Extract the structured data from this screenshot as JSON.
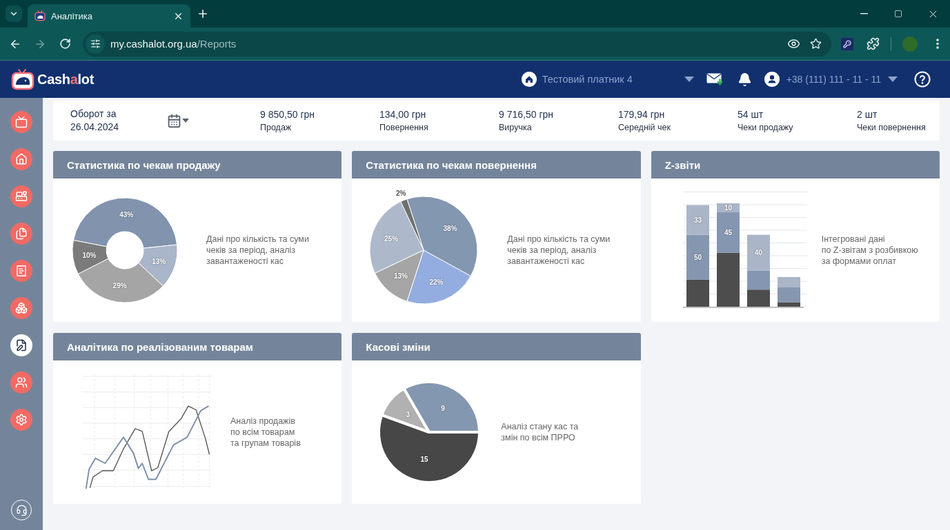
{
  "browser": {
    "tab": {
      "title": "Аналітика"
    },
    "back": {
      "disabled": false
    },
    "forward": {
      "disabled": true
    },
    "address": {
      "host": "my.cashalot.org.ua",
      "path": "/Reports"
    }
  },
  "header": {
    "logo": {
      "before": "Cash",
      "accent": "a",
      "after": "lot"
    },
    "payer": "Тестовий платник 4",
    "phone": "+38 (111) 111 - 11 - 11"
  },
  "sidebar": {
    "items": [
      {
        "selected": false
      },
      {
        "selected": false
      },
      {
        "selected": false
      },
      {
        "selected": false
      },
      {
        "selected": false
      },
      {
        "selected": false
      },
      {
        "selected": true
      },
      {
        "selected": false
      },
      {
        "selected": false
      }
    ]
  },
  "turnover": {
    "title": "Оборот за 26.04.2024",
    "stats": [
      {
        "value": "9 850,50 грн",
        "label": "Продаж"
      },
      {
        "value": "134,00 грн",
        "label": "Повернення"
      },
      {
        "value": "9 716,50 грн",
        "label": "Виручка"
      },
      {
        "value": "179,94 грн",
        "label": "Середній чек"
      },
      {
        "value": "54 шт",
        "label": "Чеки продажу"
      },
      {
        "value": "2 шт",
        "label": "Чеки повернення"
      }
    ]
  },
  "cards": [
    {
      "title": "Статистика по чекам продажу",
      "kind": "donut",
      "description": "Дані про кількість та суми\nчеків за період, аналіз\nзавантаженості кас",
      "chart_data": {
        "type": "donut",
        "values": [
          43,
          13,
          29,
          10
        ],
        "value_labels": [
          "43%",
          "13%",
          "29%",
          "10%"
        ],
        "colors": [
          "#8193ad",
          "#a9b5c9",
          "#a5a5a5",
          "#7b7b7b"
        ],
        "data_labels": true
      }
    },
    {
      "title": "Статистика по чекам повернення",
      "kind": "pie_large",
      "description": "Дані про кількість та суми\nчеків за період, аналіз\nзавантаженості кас",
      "chart_data": {
        "type": "pie",
        "values": [
          38,
          22,
          13,
          25,
          2
        ],
        "value_labels": [
          "38%",
          "22%",
          "13%",
          "25%",
          "2%"
        ],
        "colors": [
          "#8497b0",
          "#94ade0",
          "#a5a5a5",
          "#adb9cb",
          "#707070"
        ],
        "data_labels": true
      }
    },
    {
      "title": "Z-звіти",
      "kind": "bars",
      "description": "Інтегровані дані\nпо Z-звітам з розбивкою\nза формами оплат",
      "chart_data": {
        "type": "bar",
        "stacked": true,
        "data_labels": true,
        "series": [
          {
            "color": "#4d4d4d",
            "values": [
              30,
              60,
              19,
              5
            ],
            "value_labels": [
              null,
              null,
              null,
              null
            ]
          },
          {
            "color": "#8597b0",
            "values": [
              50,
              45,
              21,
              17
            ],
            "value_labels": [
              "50",
              "45",
              null,
              null
            ]
          },
          {
            "color": "#aab6c8",
            "values": [
              33,
              10,
              40,
              11
            ],
            "value_labels": [
              "33",
              "10",
              "40",
              null
            ]
          }
        ]
      }
    },
    {
      "title": "Аналітика по реалізованим товарам",
      "kind": "lines",
      "description": "Аналіз продажів\nпо всім товарам\nта групам товарів"
    },
    {
      "title": "Касові зміни",
      "kind": "pie",
      "description": "Аналіз стану кас та\nзмін по всім ПРРО",
      "chart_data": {
        "type": "pie",
        "values": [
          15,
          3,
          9
        ],
        "value_labels": [
          "15",
          "3",
          "9"
        ],
        "colors": [
          "#474747",
          "#b1b1b1",
          "#8497b0"
        ],
        "data_labels": true
      }
    }
  ]
}
